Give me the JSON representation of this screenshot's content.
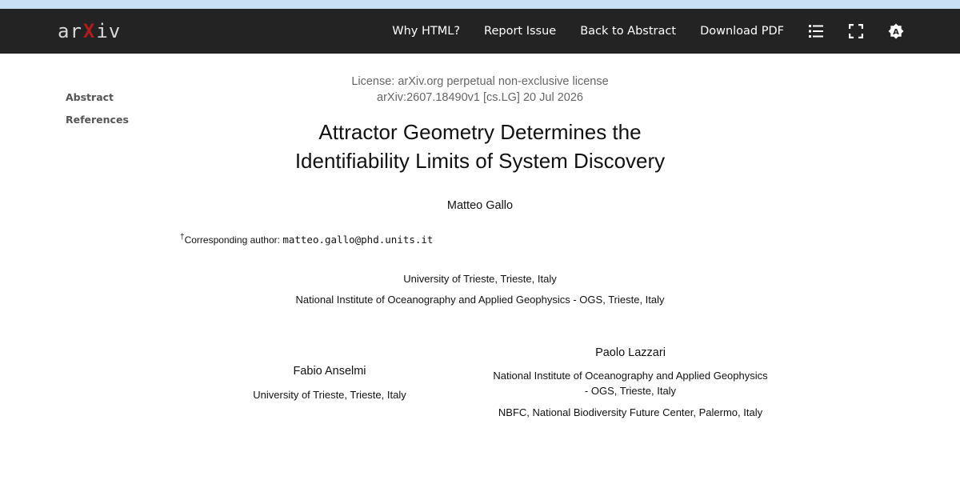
{
  "nav": {
    "logo_left": "ar",
    "logo_x": "X",
    "logo_right": "iv",
    "links": [
      "Why HTML?",
      "Report Issue",
      "Back to Abstract",
      "Download PDF"
    ],
    "icons": [
      "list-icon",
      "fullscreen-icon",
      "theme-toggle-icon"
    ]
  },
  "toc": {
    "items": [
      "Abstract",
      "References"
    ]
  },
  "paper": {
    "license": "License: arXiv.org perpetual non-exclusive license",
    "arxiv_id": "arXiv:2607.18490v1 [cs.LG] 20 Jul 2026",
    "title_line1": "Attractor Geometry Determines the",
    "title_line2": "Identifiability Limits of System Discovery",
    "main_author": "Matteo Gallo",
    "footnote_mark": "†",
    "footnote_label": "Corresponding author: ",
    "footnote_email": "matteo.gallo@phd.units.it",
    "affiliations": [
      "University of Trieste, Trieste, Italy",
      "National Institute of Oceanography and Applied Geophysics - OGS, Trieste, Italy"
    ],
    "coauthor_left": {
      "name": "Fabio Anselmi",
      "affiliation": "University of Trieste, Trieste, Italy"
    },
    "coauthor_right": {
      "name": "Paolo Lazzari",
      "affiliation_line1": "National Institute of Oceanography and Applied Geophysics",
      "affiliation_line2": "- OGS, Trieste, Italy",
      "affiliation2": "NBFC, National Biodiversity Future Center, Palermo, Italy"
    }
  },
  "colors": {
    "navbar": "#232323",
    "logo_accent": "#b31b1b",
    "toc_text": "#555555"
  }
}
